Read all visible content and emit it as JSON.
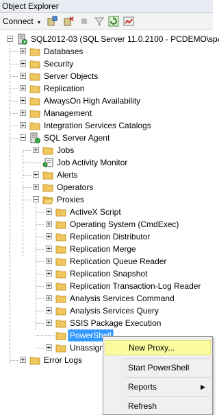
{
  "window": {
    "title": "Object Explorer"
  },
  "toolbar": {
    "connect_label": "Connect",
    "connect_caret": "▾",
    "icons": [
      "connect-object-explorer-icon",
      "disconnect-icon",
      "stop-icon",
      "filter-icon",
      "refresh-icon",
      "activity-monitor-icon"
    ]
  },
  "tree": {
    "server": "SQL2012-03 (SQL Server 11.0.2100 - PCDEMO\\spAc",
    "root_items": [
      "Databases",
      "Security",
      "Server Objects",
      "Replication",
      "AlwaysOn High Availability",
      "Management",
      "Integration Services Catalogs"
    ],
    "agent": {
      "label": "SQL Server Agent",
      "jobs": "Jobs",
      "job_activity_monitor": "Job Activity Monitor",
      "alerts": "Alerts",
      "operators": "Operators",
      "proxies": {
        "label": "Proxies",
        "children": [
          "ActiveX Script",
          "Operating System (CmdExec)",
          "Replication Distributor",
          "Replication Merge",
          "Replication Queue Reader",
          "Replication Snapshot",
          "Replication Transaction-Log Reader",
          "Analysis Services Command",
          "Analysis Services Query",
          "SSIS Package Execution"
        ],
        "selected": "PowerShell",
        "unassigned": "Unassign"
      }
    },
    "error_logs": "Error Logs"
  },
  "context_menu": {
    "new_proxy": "New Proxy...",
    "start_powershell": "Start PowerShell",
    "reports": "Reports",
    "refresh": "Refresh",
    "submenu_arrow": "▶"
  }
}
